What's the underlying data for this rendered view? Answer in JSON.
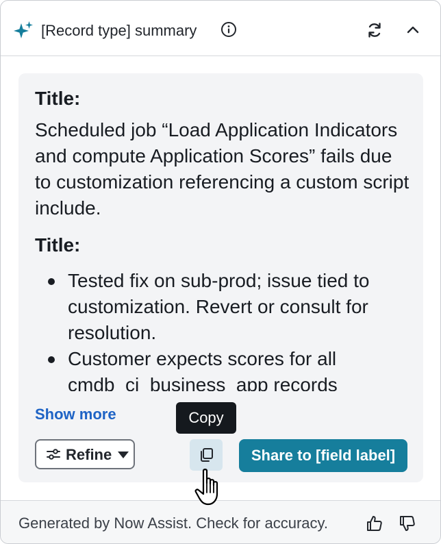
{
  "header": {
    "title": "[Record type] summary",
    "icons": [
      "sparkle-icon",
      "info-icon",
      "refresh-icon",
      "chevron-up-icon"
    ],
    "accent_color": "#167e9c"
  },
  "summary": {
    "section1_label": "Title:",
    "section1_text": "Scheduled job “Load Application Indicators and compute Application Scores” fails due to customization referencing a custom script include.",
    "section2_label": "Title:",
    "bullets": [
      "Tested fix on sub-prod; issue tied to customization. Revert or consult for resolution.",
      "Customer expects scores for all cmdb_ci_business_app records"
    ]
  },
  "actions": {
    "show_more": "Show more",
    "refine_label": "Refine",
    "copy_tooltip": "Copy",
    "share_label": "Share to [field label]"
  },
  "footer": {
    "disclaimer": "Generated by Now Assist. Check for accuracy.",
    "icons": [
      "thumbs-up-icon",
      "thumbs-down-icon"
    ]
  }
}
